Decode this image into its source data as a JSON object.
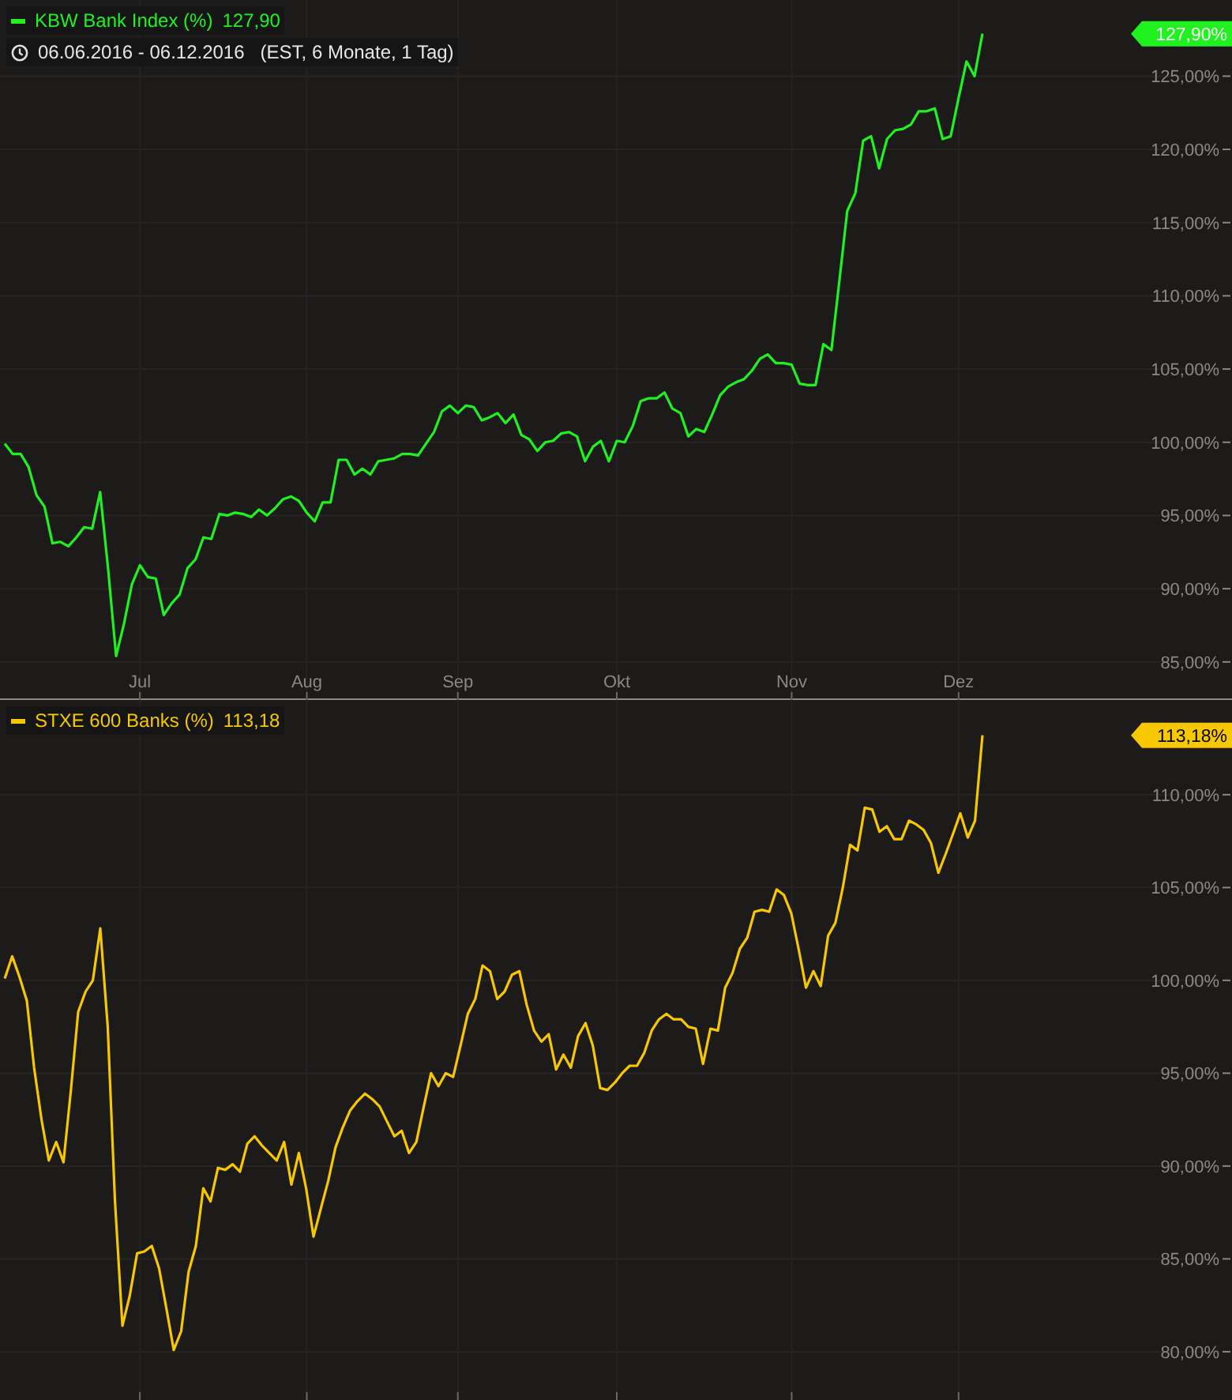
{
  "top_chart": {
    "legend": {
      "value": "127,90"
    },
    "period": {
      "range": "06.06.2016 - 06.12.2016",
      "details": "(EST, 6 Monate, 1 Tag)"
    },
    "last_value_badge": "127,90%",
    "chart_data": {
      "type": "line",
      "grid": true,
      "ylim": [
        82.4,
        130.2
      ],
      "categories": [
        null,
        null,
        null,
        null,
        null,
        null,
        null,
        null,
        null,
        null,
        null,
        null,
        null,
        null,
        null,
        null,
        null,
        "Jul",
        null,
        null,
        null,
        null,
        null,
        null,
        null,
        null,
        null,
        null,
        null,
        null,
        null,
        null,
        null,
        null,
        null,
        null,
        null,
        null,
        "Aug",
        null,
        null,
        null,
        null,
        null,
        null,
        null,
        null,
        null,
        null,
        null,
        null,
        null,
        null,
        null,
        null,
        null,
        null,
        "Sep",
        null,
        null,
        null,
        null,
        null,
        null,
        null,
        null,
        null,
        null,
        null,
        null,
        null,
        null,
        null,
        null,
        null,
        null,
        null,
        "Okt",
        null,
        null,
        null,
        null,
        null,
        null,
        null,
        null,
        null,
        null,
        null,
        null,
        null,
        null,
        null,
        null,
        null,
        null,
        null,
        null,
        null,
        "Nov",
        null,
        null,
        null,
        null,
        null,
        null,
        null,
        null,
        null,
        null,
        null,
        null,
        null,
        null,
        null,
        null,
        null,
        null,
        null,
        null,
        "Dez",
        null,
        null,
        null
      ],
      "yticks": [
        {
          "value": 85,
          "label": "85,00%"
        },
        {
          "value": 90,
          "label": "90,00%"
        },
        {
          "value": 95,
          "label": "95,00%"
        },
        {
          "value": 100,
          "label": "100,00%"
        },
        {
          "value": 105,
          "label": "105,00%"
        },
        {
          "value": 110,
          "label": "110,00%"
        },
        {
          "value": 115,
          "label": "115,00%"
        },
        {
          "value": 120,
          "label": "120,00%"
        },
        {
          "value": 125,
          "label": "125,00%"
        }
      ],
      "series": [
        {
          "name": "KBW Bank Index (%)",
          "color": "#1ff21f",
          "values": [
            99.9,
            99.2,
            99.2,
            98.3,
            96.4,
            95.6,
            93.1,
            93.2,
            92.9,
            93.5,
            94.2,
            94.1,
            96.6,
            91.4,
            85.4,
            87.6,
            90.3,
            91.6,
            90.8,
            90.7,
            88.2,
            89.0,
            89.6,
            91.4,
            92.0,
            93.5,
            93.4,
            95.1,
            95.0,
            95.2,
            95.1,
            94.9,
            95.4,
            95.0,
            95.5,
            96.1,
            96.3,
            96.0,
            95.2,
            94.6,
            95.9,
            95.9,
            98.8,
            98.8,
            97.8,
            98.2,
            97.8,
            98.7,
            98.8,
            98.9,
            99.2,
            99.2,
            99.1,
            99.9,
            100.7,
            102.1,
            102.5,
            102.0,
            102.5,
            102.4,
            101.5,
            101.7,
            102.0,
            101.3,
            101.9,
            100.5,
            100.2,
            99.4,
            100.0,
            100.1,
            100.6,
            100.7,
            100.4,
            98.7,
            99.7,
            100.1,
            98.7,
            100.1,
            100.0,
            101.1,
            102.8,
            103.0,
            103.0,
            103.4,
            102.3,
            102.0,
            100.4,
            100.9,
            100.7,
            101.9,
            103.2,
            103.8,
            104.1,
            104.3,
            104.9,
            105.7,
            106.0,
            105.4,
            105.4,
            105.3,
            104.0,
            103.9,
            103.9,
            106.7,
            106.3,
            111.0,
            115.8,
            117.0,
            120.6,
            120.9,
            118.7,
            120.7,
            121.3,
            121.4,
            121.7,
            122.6,
            122.6,
            122.8,
            120.7,
            120.9,
            123.5,
            126.0,
            125.0,
            127.9
          ]
        }
      ]
    }
  },
  "bottom_chart": {
    "legend": {
      "value": "113,18"
    },
    "last_value_badge": "113,18%",
    "chart_data": {
      "type": "line",
      "grid": true,
      "ylim": [
        77.4,
        115.1
      ],
      "categories": [
        null,
        null,
        null,
        null,
        null,
        null,
        null,
        null,
        null,
        null,
        null,
        null,
        null,
        null,
        null,
        null,
        null,
        null,
        null,
        null,
        null,
        null,
        null,
        null,
        null,
        null,
        null,
        null,
        null,
        null,
        null,
        null,
        null,
        null,
        null,
        null,
        null,
        null,
        null,
        null,
        null,
        null,
        null,
        null,
        null,
        null,
        null,
        null,
        null,
        null,
        null,
        null,
        null,
        null,
        null,
        null,
        null,
        null,
        null,
        null,
        null,
        null,
        null,
        null,
        null,
        null,
        null,
        null,
        null,
        null,
        null,
        null,
        null,
        null,
        null,
        null,
        null,
        null,
        null,
        null,
        null,
        null,
        null,
        null,
        null,
        null,
        null,
        null,
        null,
        null,
        null,
        null,
        null,
        null,
        null,
        null,
        null,
        null,
        null,
        null,
        null,
        null,
        null,
        null,
        null,
        null,
        null,
        null,
        null,
        null,
        null,
        null,
        null,
        null,
        null,
        null,
        null,
        null,
        null,
        null,
        null,
        null,
        null,
        null,
        null,
        null,
        null,
        null,
        null,
        null,
        null,
        null,
        null,
        null
      ],
      "yticks": [
        {
          "value": 80,
          "label": "80,00%"
        },
        {
          "value": 85,
          "label": "85,00%"
        },
        {
          "value": 90,
          "label": "90,00%"
        },
        {
          "value": 95,
          "label": "95,00%"
        },
        {
          "value": 100,
          "label": "100,00%"
        },
        {
          "value": 105,
          "label": "105,00%"
        },
        {
          "value": 110,
          "label": "110,00%"
        }
      ],
      "series": [
        {
          "name": "STXE 600 Banks (%)",
          "color": "#f7c700",
          "values": [
            100.1,
            101.3,
            100.2,
            98.9,
            95.3,
            92.5,
            90.3,
            91.3,
            90.2,
            94.1,
            98.3,
            99.4,
            100.0,
            102.8,
            97.5,
            88.1,
            81.4,
            83.0,
            85.3,
            85.4,
            85.7,
            84.5,
            82.3,
            80.1,
            81.1,
            84.3,
            85.7,
            88.8,
            88.1,
            89.9,
            89.8,
            90.1,
            89.7,
            91.2,
            91.6,
            91.1,
            90.7,
            90.3,
            91.3,
            89.0,
            90.7,
            88.8,
            86.2,
            87.7,
            89.2,
            91.0,
            92.1,
            93.0,
            93.5,
            93.9,
            93.6,
            93.2,
            92.4,
            91.6,
            91.9,
            90.7,
            91.3,
            93.2,
            95.0,
            94.3,
            95.0,
            94.8,
            96.5,
            98.2,
            99.0,
            100.8,
            100.5,
            99.0,
            99.4,
            100.3,
            100.5,
            98.7,
            97.3,
            96.7,
            97.1,
            95.2,
            96.0,
            95.3,
            97.0,
            97.7,
            96.5,
            94.2,
            94.1,
            94.5,
            95.0,
            95.4,
            95.4,
            96.1,
            97.3,
            97.9,
            98.2,
            97.9,
            97.9,
            97.5,
            97.4,
            95.5,
            97.4,
            97.3,
            99.6,
            100.4,
            101.7,
            102.3,
            103.7,
            103.8,
            103.7,
            104.9,
            104.6,
            103.6,
            101.7,
            99.6,
            100.5,
            99.7,
            102.4,
            103.1,
            105.0,
            107.3,
            107.0,
            109.3,
            109.2,
            108.0,
            108.3,
            107.6,
            107.6,
            108.6,
            108.4,
            108.1,
            107.4,
            105.8,
            106.8,
            107.9,
            109.0,
            107.7,
            108.6,
            113.2
          ]
        }
      ]
    }
  }
}
